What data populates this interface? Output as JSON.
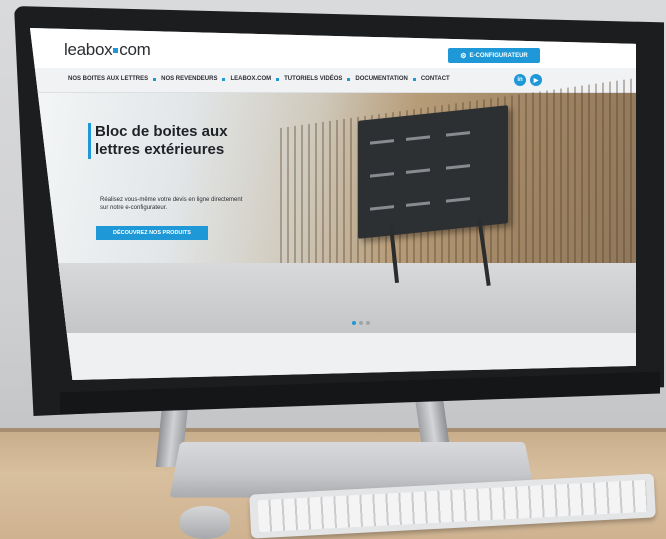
{
  "site": {
    "logo_prefix": "leabox",
    "logo_suffix": "com",
    "configurator_label": "E-CONFIGURATEUR",
    "nav": [
      {
        "label": "NOS BOITES AUX LETTRES"
      },
      {
        "label": "NOS REVENDEURS"
      },
      {
        "label": "LEABOX.COM"
      },
      {
        "label": "TUTORIELS VIDÉOS"
      },
      {
        "label": "DOCUMENTATION"
      },
      {
        "label": "CONTACT"
      }
    ],
    "social": {
      "linkedin": "in",
      "youtube": "▶"
    }
  },
  "hero": {
    "title": "Bloc de boites aux lettres extérieures",
    "subtitle": "Réalisez vous-même votre devis en ligne directement sur notre e-configurateur.",
    "button_label": "DÉCOUVREZ NOS PRODUITS",
    "slide_count": 3,
    "active_slide": 1
  },
  "colors": {
    "accent": "#1e98d6",
    "text": "#1f2327"
  }
}
